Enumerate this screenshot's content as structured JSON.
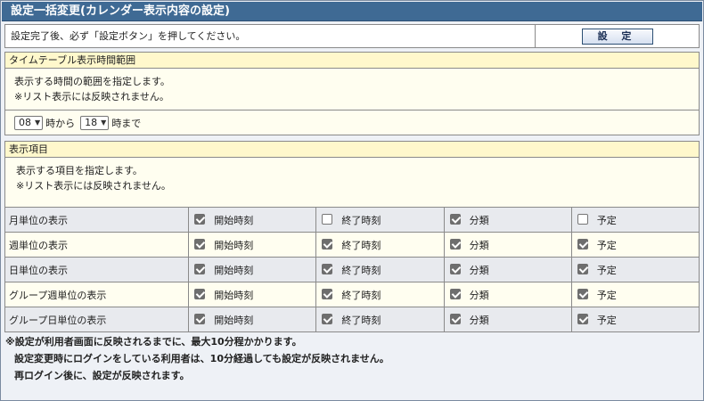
{
  "title": "設定一括変更(カレンダー表示内容の設定)",
  "notice": {
    "text": "設定完了後、必ず「設定ボタン」を押してください。",
    "button_label": "設 定"
  },
  "timetable": {
    "heading": "タイムテーブル表示時間範囲",
    "desc_1": "表示する時間の範囲を指定します。",
    "desc_2": "※リスト表示には反映されません。",
    "start_hour": "08",
    "start_suffix": "時から",
    "end_hour": "18",
    "end_suffix": "時まで"
  },
  "display_items": {
    "heading": "表示項目",
    "desc_1": "表示する項目を指定します。",
    "desc_2": "※リスト表示には反映されません。",
    "columns": [
      "開始時刻",
      "終了時刻",
      "分類",
      "予定"
    ],
    "rows": [
      {
        "label": "月単位の表示",
        "checked": [
          true,
          false,
          true,
          false
        ]
      },
      {
        "label": "週単位の表示",
        "checked": [
          true,
          true,
          true,
          true
        ]
      },
      {
        "label": "日単位の表示",
        "checked": [
          true,
          true,
          true,
          true
        ]
      },
      {
        "label": "グループ週単位の表示",
        "checked": [
          true,
          true,
          true,
          true
        ]
      },
      {
        "label": "グループ日単位の表示",
        "checked": [
          true,
          true,
          true,
          true
        ]
      }
    ]
  },
  "footer": {
    "line_1": "※設定が利用者画面に反映されるまでに、最大10分程かかります。",
    "line_2": "設定変更時にログインをしている利用者は、10分経過しても設定が反映されません。",
    "line_3": "再ログイン後に、設定が反映されます。"
  }
}
